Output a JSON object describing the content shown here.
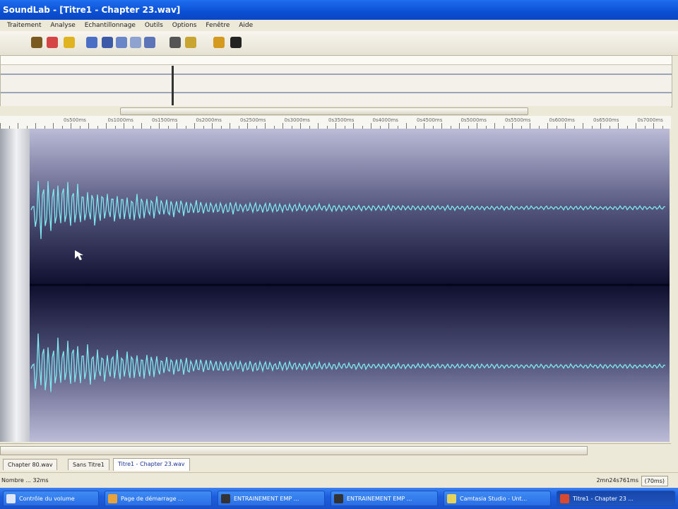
{
  "window": {
    "title": "SoundLab - [Titre1 - Chapter 23.wav]"
  },
  "menu": {
    "items": [
      "Traitement",
      "Analyse",
      "Echantillonnage",
      "Outils",
      "Options",
      "Fenêtre",
      "Aide"
    ]
  },
  "toolbar": {
    "icons": [
      "pencil-icon",
      "eraser-icon",
      "speaker-icon",
      "select-icon",
      "text-icon",
      "region-icon",
      "grid-icon",
      "cursor-icon",
      "hand-icon",
      "zoom-icon",
      "paint-icon",
      "wave-icon"
    ]
  },
  "ruler": {
    "labels": [
      "0s500ms",
      "0s1000ms",
      "0s1500ms",
      "0s2000ms",
      "0s2500ms",
      "0s3000ms",
      "0s3500ms",
      "0s4000ms",
      "0s4500ms",
      "0s5000ms",
      "0s5500ms",
      "0s6000ms",
      "0s6500ms",
      "0s7000ms"
    ]
  },
  "tabs": [
    "Chapter 80.wav",
    "Sans Titre1",
    "Titre1 - Chapter 23.wav"
  ],
  "status": {
    "left": "Nombre ... 32ms",
    "position": "2mn24s761ms",
    "zoom": "(70ms)"
  },
  "taskbar": {
    "items": [
      "Contrôle du volume",
      "Page de démarrage ...",
      "ENTRAINEMENT EMP ...",
      "ENTRAINEMENT EMP ...",
      "Camtasia Studio - Unt...",
      "Titre1 - Chapter 23 ..."
    ]
  },
  "colors": {
    "waveform": "#7fe8f0",
    "wave_background": "#2c2d55",
    "titlebar": "#0a4fd4",
    "taskbar": "#1d5fe0"
  }
}
